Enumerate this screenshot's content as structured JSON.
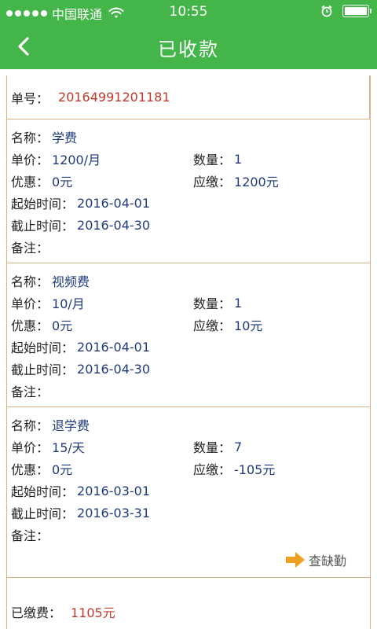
{
  "status_bar": {
    "carrier": "中国联通",
    "time": "10:55"
  },
  "nav": {
    "title": "已收款"
  },
  "order": {
    "label": "单号：",
    "number": "20164991201181"
  },
  "labels": {
    "name": "名称：",
    "unit_price": "单价：",
    "quantity": "数量：",
    "discount": "优惠：",
    "payable": "应缴：",
    "start_time": "起始时间：",
    "end_time": "截止时间：",
    "note": "备注："
  },
  "fees": [
    {
      "name": "学费",
      "unit_price": "1200/月",
      "quantity": "1",
      "discount": "0元",
      "payable": "1200元",
      "start_time": "2016-04-01",
      "end_time": "2016-04-30",
      "note": ""
    },
    {
      "name": "视频费",
      "unit_price": "10/月",
      "quantity": "1",
      "discount": "0元",
      "payable": "10元",
      "start_time": "2016-04-01",
      "end_time": "2016-04-30",
      "note": ""
    },
    {
      "name": "退学费",
      "unit_price": "15/天",
      "quantity": "7",
      "discount": "0元",
      "payable": "-105元",
      "start_time": "2016-03-01",
      "end_time": "2016-03-31",
      "note": ""
    }
  ],
  "actions": {
    "check_absence": "查缺勤"
  },
  "summary": {
    "paid_label": "已缴费：",
    "paid_amount": "1105元"
  },
  "colors": {
    "primary": "#44b549",
    "border": "#d8b48a",
    "value_blue": "#1f3b7a",
    "accent_red": "#c0392b",
    "action_orange": "#f0a020"
  }
}
